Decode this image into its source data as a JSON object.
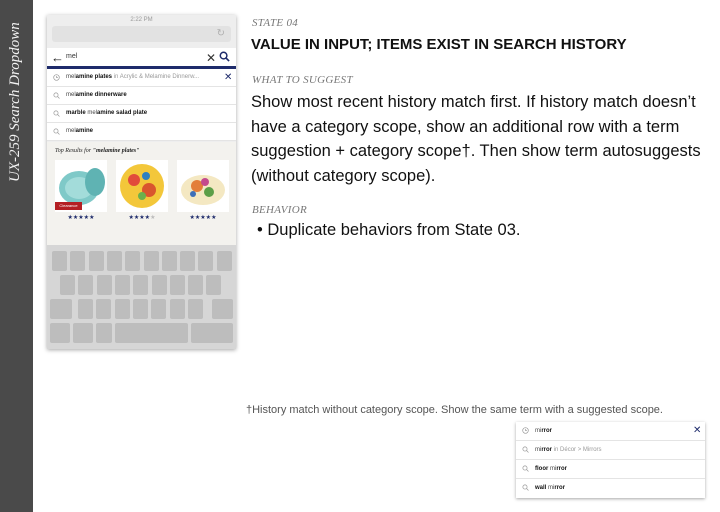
{
  "sidebar": {
    "title": "UX-259 Search Dropdown"
  },
  "phone": {
    "status_time": "2:22 PM",
    "search_query": "mel",
    "dropdown": [
      {
        "icon": "history-icon",
        "prefix": "mel",
        "bold": "amine plates",
        "scope": "in Acrylic & Melamine Dinnerw...",
        "removable": true
      },
      {
        "icon": "search-icon",
        "prefix": "mel",
        "bold": "amine dinnerware",
        "scope": "",
        "removable": false
      },
      {
        "icon": "search-icon",
        "prefix_bold": "marble ",
        "prefix": "mel",
        "bold": "amine salad plate",
        "scope": "",
        "removable": false
      },
      {
        "icon": "search-icon",
        "prefix": "mel",
        "bold": "amine",
        "scope": "",
        "removable": false
      }
    ],
    "top_results": {
      "label": "Top Results for ",
      "query": "\"melamine plates\"",
      "products": [
        {
          "image": "teal-plates",
          "badge": "Clearance",
          "rating": 5
        },
        {
          "image": "floral-plates",
          "badge": "",
          "rating": 4
        },
        {
          "image": "botanical-plates",
          "badge": "",
          "rating": 5
        }
      ]
    }
  },
  "state": {
    "label": "STATE 04",
    "heading": "VALUE IN INPUT; ITEMS EXIST IN SEARCH HISTORY"
  },
  "suggest": {
    "label": "WHAT TO SUGGEST",
    "body": "Show most recent history match first. If history match doesn’t have a category scope, show an additional row with a term suggestion + category scope†. Then show term autosuggests (without category scope)."
  },
  "behavior": {
    "label": "BEHAVIOR",
    "bullet": "• Duplicate behaviors from State 03."
  },
  "footnote": "†History match without category scope. Show the same term with a suggested scope.",
  "mini_dropdown": [
    {
      "icon": "history-icon",
      "prefix": "mi",
      "bold": "rror",
      "scope": "",
      "removable": true
    },
    {
      "icon": "search-icon",
      "prefix": "mi",
      "bold": "rror",
      "scope": " in Décor > Mirrors",
      "removable": false
    },
    {
      "icon": "search-icon",
      "prefix_bold": "floor ",
      "prefix": "mi",
      "bold": "rror",
      "scope": "",
      "removable": false
    },
    {
      "icon": "search-icon",
      "prefix_bold": "wall ",
      "prefix": "mi",
      "bold": "rror",
      "scope": "",
      "removable": false
    }
  ],
  "colors": {
    "brand_navy": "#1e2b6b",
    "clearance_red": "#b41f23",
    "sidebar": "#4a4a4a"
  }
}
